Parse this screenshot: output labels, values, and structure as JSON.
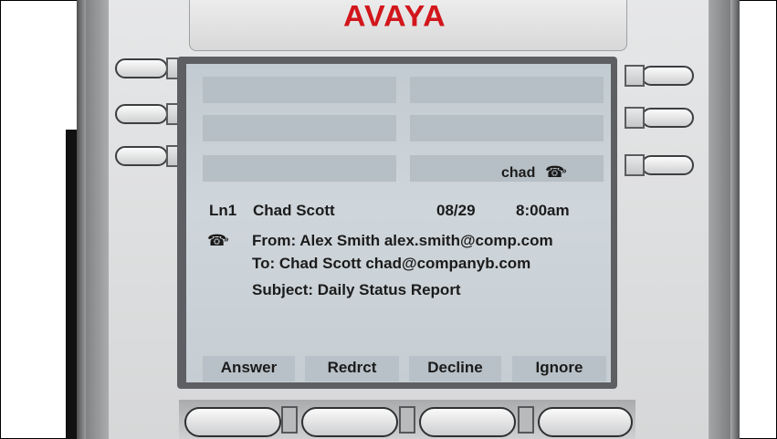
{
  "brand": {
    "logo": "AVAYA",
    "logo_color": "#d2161c"
  },
  "feature_key": {
    "label": "chad",
    "icon": "ringing-phone-icon"
  },
  "call": {
    "line": "Ln1",
    "caller_name": "Chad Scott",
    "date": "08/29",
    "time": "8:00am",
    "icon": "ringing-phone-icon",
    "from": "From: Alex Smith  alex.smith@comp.com",
    "to": "To: Chad Scott  chad@companyb.com",
    "subject": "Subject: Daily Status Report"
  },
  "softkeys": [
    {
      "label": "Answer"
    },
    {
      "label": "Redrct"
    },
    {
      "label": "Decline"
    },
    {
      "label": "Ignore"
    }
  ],
  "screen_color": "#cbd3d8"
}
